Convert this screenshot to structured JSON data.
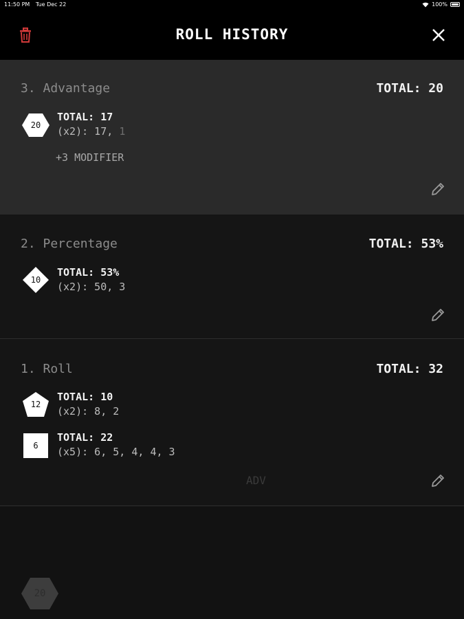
{
  "status_bar": {
    "time": "11:50 PM",
    "date": "Tue Dec 22",
    "battery": "100%"
  },
  "header": {
    "title": "ROLL HISTORY",
    "trash_icon": "trash-icon",
    "close_icon": "close-icon"
  },
  "colors": {
    "accent_red": "#d23a3a",
    "header_bg": "#000000",
    "latest_entry_bg": "#2a2a2a",
    "entry_bg": "#151515"
  },
  "entries": [
    {
      "title": "3. Advantage",
      "total": "TOTAL: 20",
      "rolls": [
        {
          "die": "20",
          "die_shape": "hexagon-d20-icon",
          "total": "TOTAL: 17",
          "detail_kept": "(x2): 17,",
          "detail_dropped": "1"
        }
      ],
      "modifier": "+3 MODIFIER"
    },
    {
      "title": "2. Percentage",
      "total": "TOTAL: 53%",
      "rolls": [
        {
          "die": "10",
          "die_shape": "diamond-d10-icon",
          "total": "TOTAL: 53%",
          "detail": "(x2): 50, 3"
        }
      ]
    },
    {
      "title": "1. Roll",
      "total": "TOTAL: 32",
      "rolls": [
        {
          "die": "12",
          "die_shape": "pentagon-d12-icon",
          "total": "TOTAL: 10",
          "detail": "(x2): 8, 2"
        },
        {
          "die": "6",
          "die_shape": "square-d6-icon",
          "total": "TOTAL: 22",
          "detail": "(x5): 6, 5, 4, 4, 3"
        }
      ]
    }
  ],
  "background": {
    "adv_label": "ADV",
    "ghost_die": "20"
  }
}
